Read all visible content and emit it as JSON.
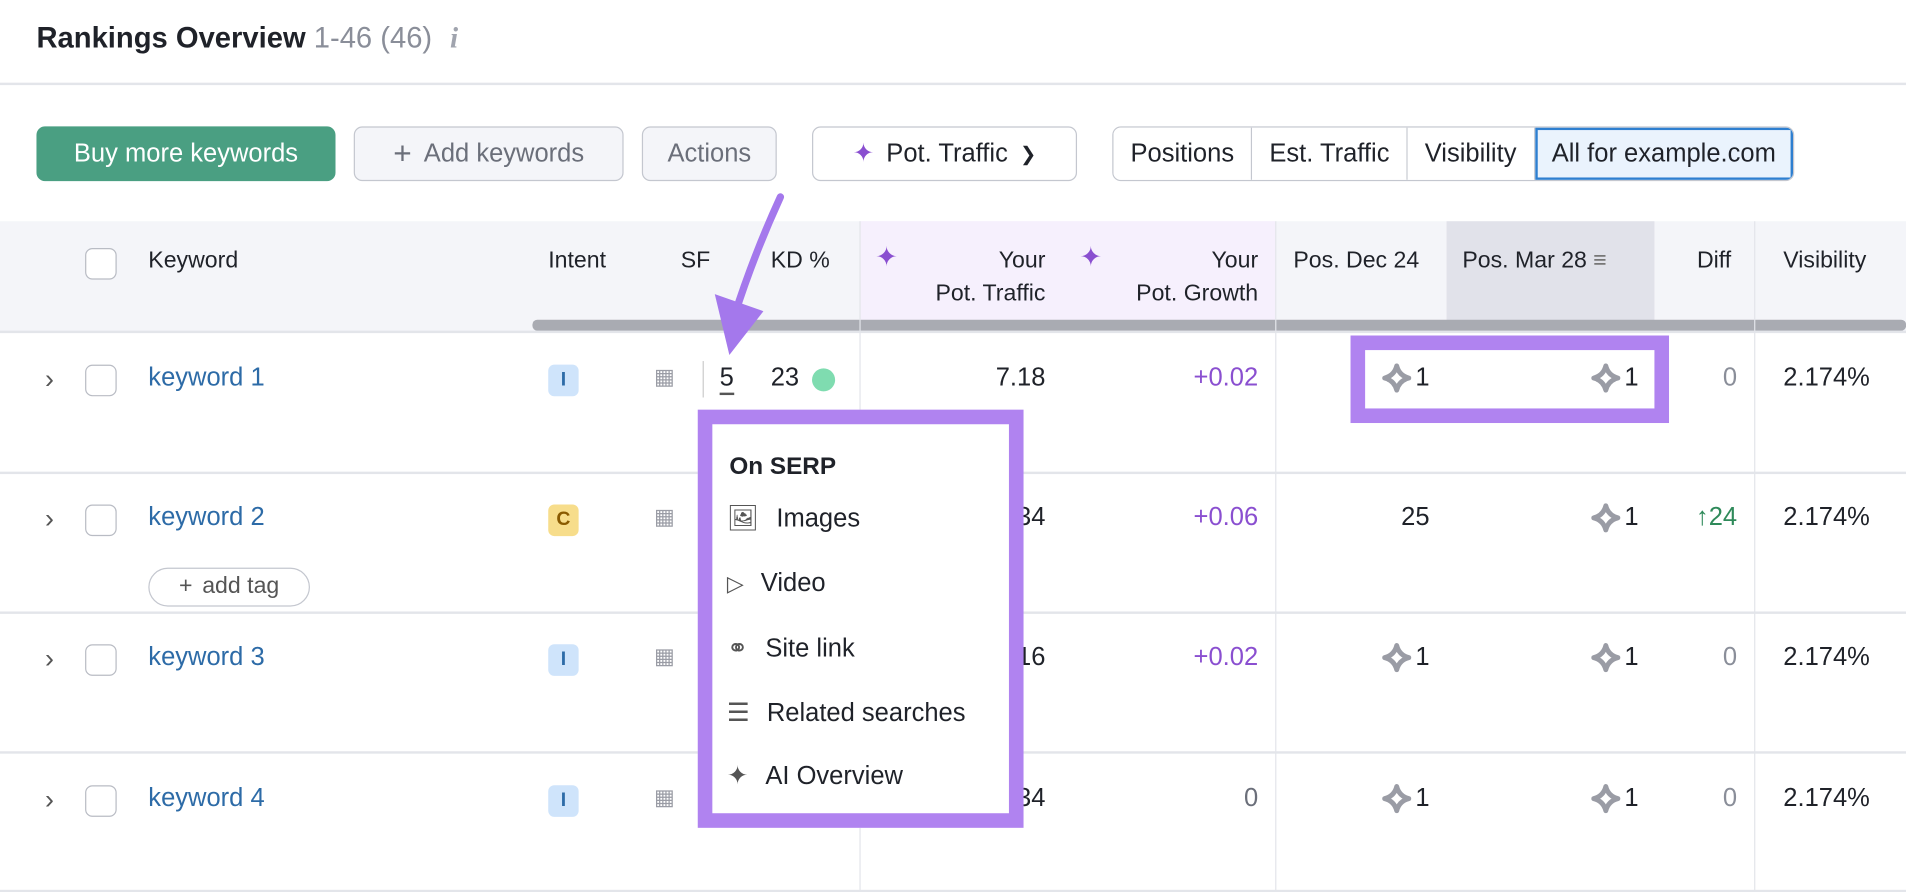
{
  "header": {
    "title": "Rankings Overview",
    "range": "1-46 (46)",
    "info_icon": "info-icon"
  },
  "toolbar": {
    "buy_label": "Buy more keywords",
    "add_label": "Add keywords",
    "actions_label": "Actions",
    "pot_traffic_label": "Pot. Traffic",
    "segments": [
      "Positions",
      "Est. Traffic",
      "Visibility",
      "All for example.com"
    ],
    "selected_segment": "All for example.com",
    "accent": "#4a9f82"
  },
  "table": {
    "columns": {
      "keyword": "Keyword",
      "intent": "Intent",
      "sf": "SF",
      "kd": "KD %",
      "pot_traffic_1": "Your",
      "pot_traffic_2": "Pot. Traffic",
      "pot_growth_1": "Your",
      "pot_growth_2": "Pot. Growth",
      "pos_dec": "Pos. Dec 24",
      "pos_mar": "Pos. Mar 28",
      "diff": "Diff",
      "visibility": "Visibility"
    },
    "rows": [
      {
        "keyword": "keyword 1",
        "intent": "I",
        "sf": "5",
        "kd": "23",
        "pot_traffic": "7.18",
        "pot_growth": "+0.02",
        "pos_dec": "1",
        "pos_mar": "1",
        "diff": "0",
        "visibility": "2.174%"
      },
      {
        "keyword": "keyword 2",
        "intent": "C",
        "add_tag": "add tag",
        "pot_traffic": "34",
        "pot_growth": "+0.06",
        "pos_dec": "25",
        "pos_mar": "1",
        "diff": "24",
        "visibility": "2.174%"
      },
      {
        "keyword": "keyword 3",
        "intent": "I",
        "pot_traffic": "16",
        "pot_growth": "+0.02",
        "pos_dec": "1",
        "pos_mar": "1",
        "diff": "0",
        "visibility": "2.174%"
      },
      {
        "keyword": "keyword 4",
        "intent": "I",
        "pot_traffic": "34",
        "pot_growth": "0",
        "pos_dec": "1",
        "pos_mar": "1",
        "diff": "0",
        "visibility": "2.174%"
      }
    ]
  },
  "popup": {
    "title": "On SERP",
    "items": [
      {
        "label": "Images",
        "icon": "image-icon"
      },
      {
        "label": "Video",
        "icon": "video-icon"
      },
      {
        "label": "Site link",
        "icon": "link-icon"
      },
      {
        "label": "Related searches",
        "icon": "list-icon"
      },
      {
        "label": "AI Overview",
        "icon": "ai-overview-icon"
      }
    ]
  },
  "colors": {
    "highlight": "#b083f0",
    "link": "#2d6ba7",
    "growth": "#8a4fd0",
    "up": "#2f8a5a"
  }
}
